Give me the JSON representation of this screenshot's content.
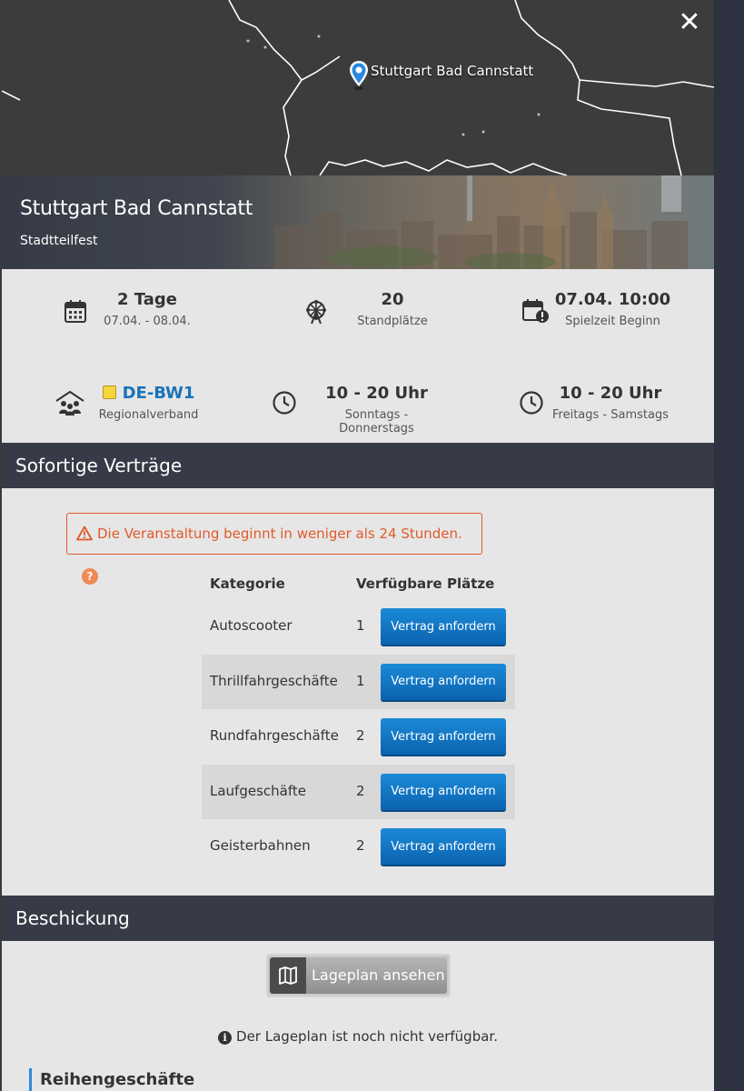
{
  "map": {
    "location_label": "Stuttgart Bad Cannstatt",
    "close_label": "✕"
  },
  "hero": {
    "title": "Stuttgart Bad Cannstatt",
    "subtitle": "Stadtteilfest"
  },
  "stats": {
    "duration": {
      "main": "2 Tage",
      "sub": "07.04. - 08.04.",
      "icon": "calendar-icon"
    },
    "stands": {
      "main": "20",
      "sub": "Standplätze",
      "icon": "ferris-wheel-icon"
    },
    "start": {
      "main": "07.04. 10:00",
      "sub": "Spielzeit Beginn",
      "icon": "calendar-alert-icon"
    },
    "region": {
      "main": "DE-BW1",
      "sub": "Regionalverband",
      "icon": "association-icon",
      "badge_color": "#f5d53a"
    },
    "hours_weekday": {
      "main": "10 - 20 Uhr",
      "sub": "Sonntags - Donnerstags",
      "icon": "clock-icon"
    },
    "hours_weekend": {
      "main": "10 - 20 Uhr",
      "sub": "Freitags - Samstags",
      "icon": "clock-icon"
    }
  },
  "contracts": {
    "header": "Sofortige Verträge",
    "alert": "Die Veranstaltung beginnt in weniger als 24 Stunden.",
    "alert_help": "?",
    "col_category": "Kategorie",
    "col_available": "Verfügbare Plätze",
    "rows": [
      {
        "category": "Autoscooter",
        "available": "1",
        "button": "Vertrag anfordern"
      },
      {
        "category": "Thrillfahrgeschäfte",
        "available": "1",
        "button": "Vertrag anfordern"
      },
      {
        "category": "Rundfahrgeschäfte",
        "available": "2",
        "button": "Vertrag anfordern"
      },
      {
        "category": "Laufgeschäfte",
        "available": "2",
        "button": "Vertrag anfordern"
      },
      {
        "category": "Geisterbahnen",
        "available": "2",
        "button": "Vertrag anfordern"
      }
    ]
  },
  "beschickung": {
    "header": "Beschickung",
    "map_button": "Lageplan ansehen",
    "note": "Der Lageplan ist noch nicht verfügbar.",
    "subsection": "Reihengeschäfte"
  },
  "colors": {
    "accent": "#1a73b8",
    "alert": "#e05a2a",
    "button": "#0b63b0",
    "header_bg": "#373b47"
  }
}
